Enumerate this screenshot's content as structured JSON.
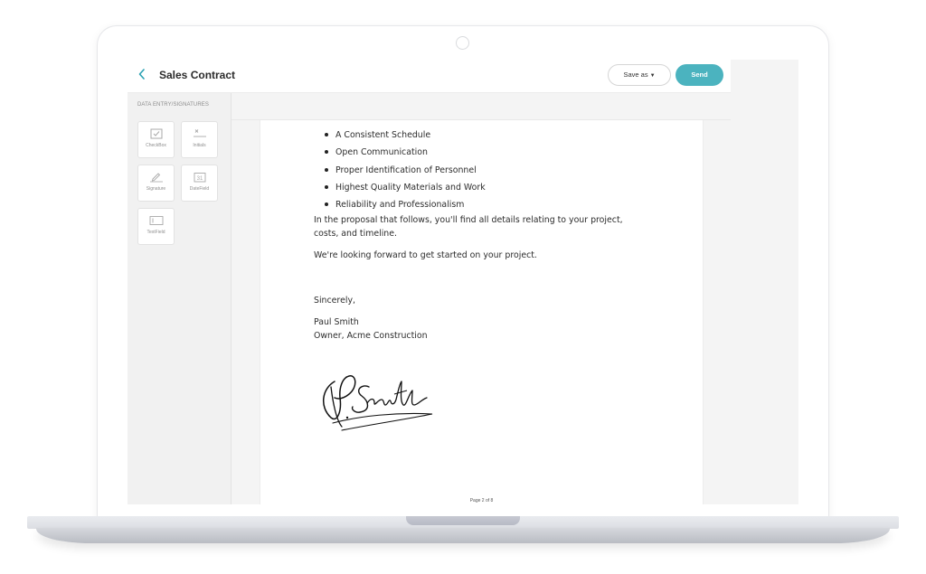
{
  "header": {
    "back_icon": "chevron-left-icon",
    "title": "Sales Contract",
    "save_as_label": "Save as",
    "save_as_caret_icon": "caret-down-icon",
    "send_label": "Send"
  },
  "panel": {
    "title": "DATA ENTRY/SIGNATURES",
    "tools": [
      {
        "label": "CheckBox",
        "icon": "checkbox-icon"
      },
      {
        "label": "Initials",
        "icon": "initials-icon"
      },
      {
        "label": "Signature",
        "icon": "signature-pen-icon"
      },
      {
        "label": "DateField",
        "icon": "date-field-icon"
      },
      {
        "label": "TextField",
        "icon": "text-field-icon"
      }
    ]
  },
  "document": {
    "bullets": [
      "A Consistent Schedule",
      "Open Communication",
      "Proper Identification of Personnel",
      "Highest Quality Materials and Work",
      "Reliability and Professionalism"
    ],
    "paragraph_1": "In the proposal that follows, you'll find all details relating to your project, costs, and timeline.",
    "paragraph_2": "We're looking forward to get started on your project.",
    "closing": "Sincerely,",
    "signer_name": "Paul Smith",
    "signer_title": "Owner, Acme Construction",
    "signature_text": "P. Smith",
    "page_indicator": "Page 2 of 8"
  },
  "colors": {
    "accent": "#4bb3bf",
    "back_arrow": "#2aa1b3"
  }
}
